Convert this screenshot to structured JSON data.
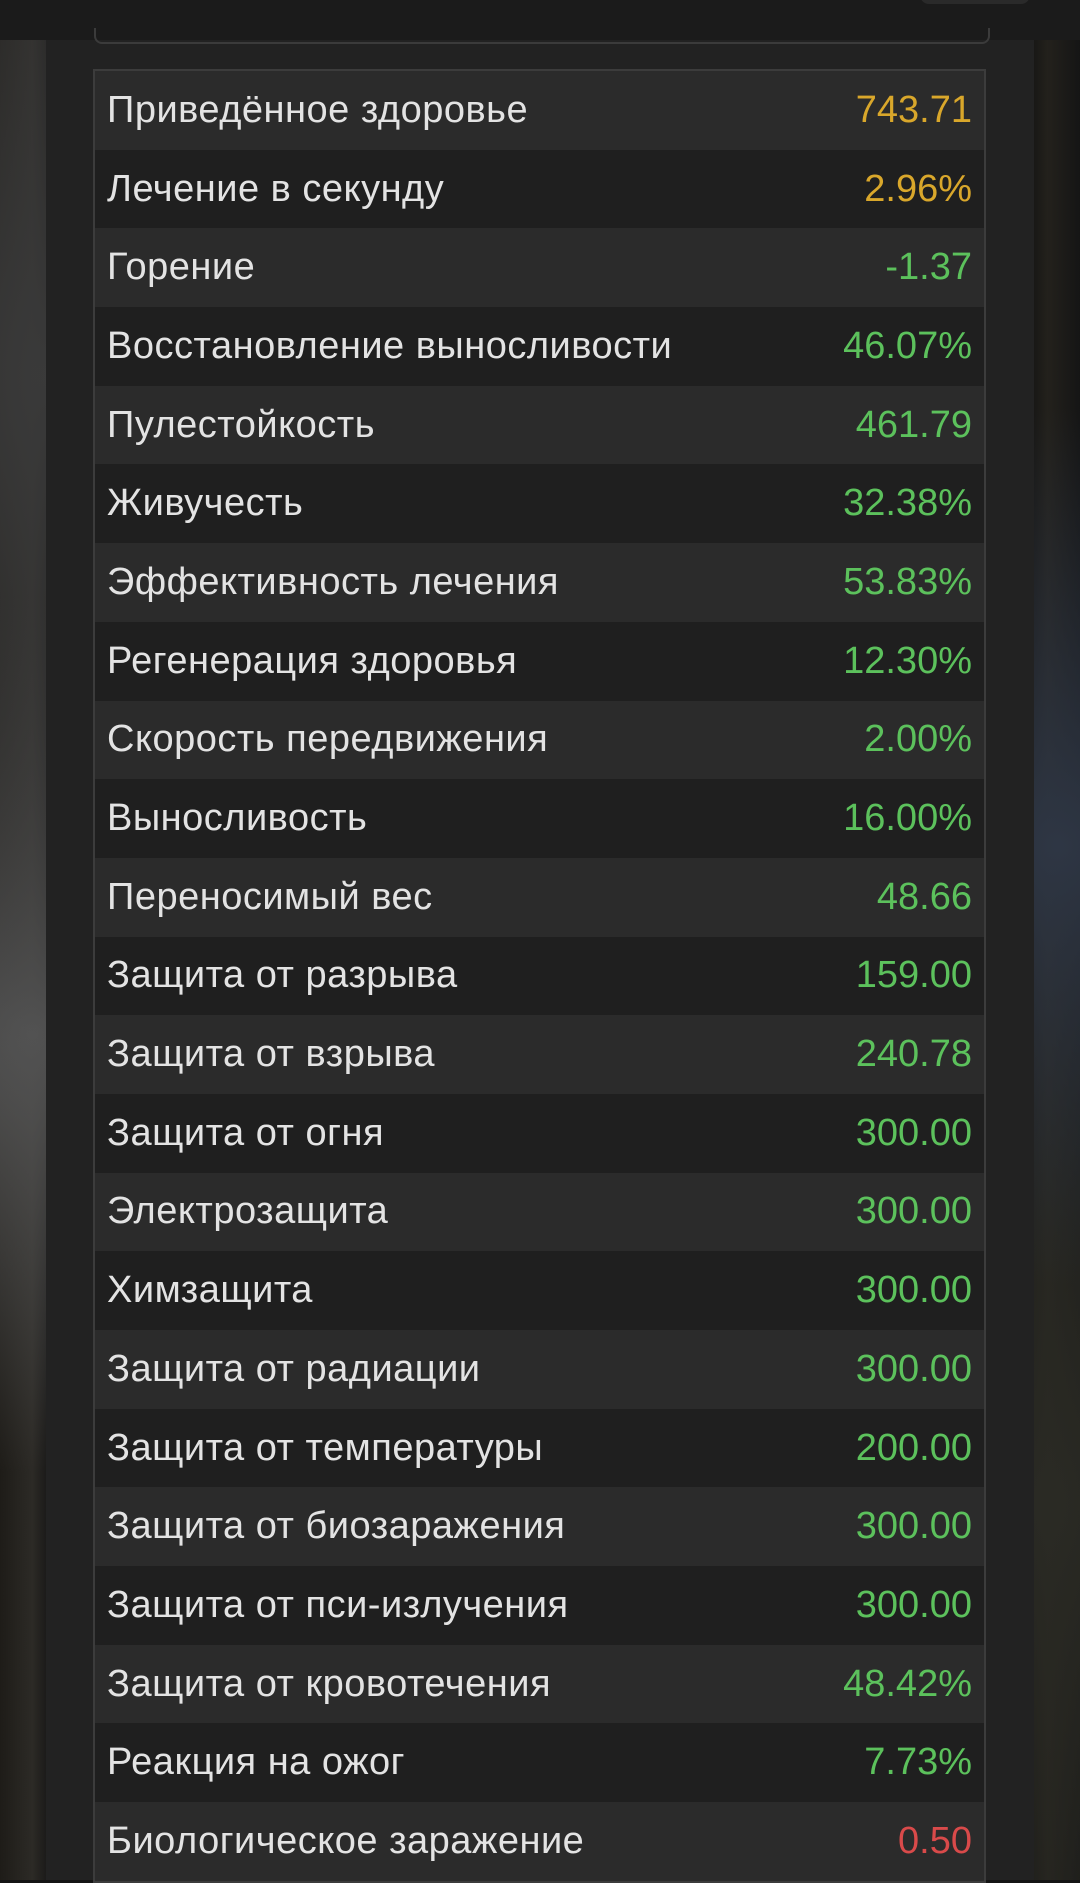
{
  "colors": {
    "gold": "#d9a72b",
    "green": "#5cc15c",
    "red": "#d94a4a",
    "label": "#e3e3e3"
  },
  "stats": [
    {
      "label": "Приведённое здоровье",
      "value": "743.71",
      "color": "gold"
    },
    {
      "label": "Лечение в секунду",
      "value": "2.96%",
      "color": "gold"
    },
    {
      "label": "Горение",
      "value": "-1.37",
      "color": "green"
    },
    {
      "label": "Восстановление выносливости",
      "value": "46.07%",
      "color": "green"
    },
    {
      "label": "Пулестойкость",
      "value": "461.79",
      "color": "green"
    },
    {
      "label": "Живучесть",
      "value": "32.38%",
      "color": "green"
    },
    {
      "label": "Эффективность лечения",
      "value": "53.83%",
      "color": "green"
    },
    {
      "label": "Регенерация здоровья",
      "value": "12.30%",
      "color": "green"
    },
    {
      "label": "Скорость передвижения",
      "value": "2.00%",
      "color": "green"
    },
    {
      "label": "Выносливость",
      "value": "16.00%",
      "color": "green"
    },
    {
      "label": "Переносимый вес",
      "value": "48.66",
      "color": "green"
    },
    {
      "label": "Защита от разрыва",
      "value": "159.00",
      "color": "green"
    },
    {
      "label": "Защита от взрыва",
      "value": "240.78",
      "color": "green"
    },
    {
      "label": "Защита от огня",
      "value": "300.00",
      "color": "green"
    },
    {
      "label": "Электрозащита",
      "value": "300.00",
      "color": "green"
    },
    {
      "label": "Химзащита",
      "value": "300.00",
      "color": "green"
    },
    {
      "label": "Защита от радиации",
      "value": "300.00",
      "color": "green"
    },
    {
      "label": "Защита от температуры",
      "value": "200.00",
      "color": "green"
    },
    {
      "label": "Защита от биозаражения",
      "value": "300.00",
      "color": "green"
    },
    {
      "label": "Защита от пси-излучения",
      "value": "300.00",
      "color": "green"
    },
    {
      "label": "Защита от кровотечения",
      "value": "48.42%",
      "color": "green"
    },
    {
      "label": "Реакция на ожог",
      "value": "7.73%",
      "color": "green"
    },
    {
      "label": "Биологическое заражение",
      "value": "0.50",
      "color": "red"
    }
  ]
}
